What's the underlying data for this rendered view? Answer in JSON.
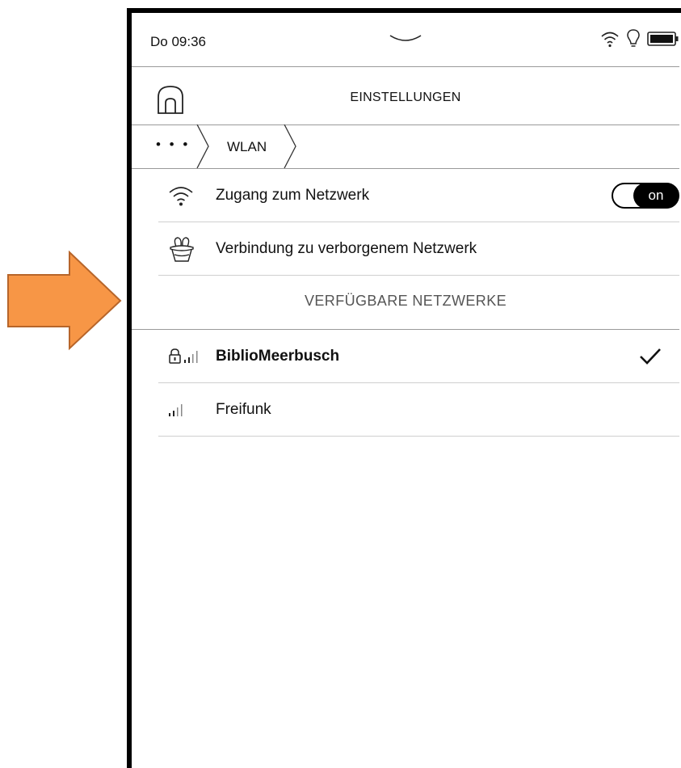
{
  "status_bar": {
    "time": "Do 09:36"
  },
  "header": {
    "title": "EINSTELLUNGEN"
  },
  "breadcrumb": {
    "more": "• • •",
    "current": "WLAN"
  },
  "settings": {
    "network_access": {
      "label": "Zugang zum Netzwerk",
      "toggle": "on"
    },
    "hidden_network": {
      "label": "Verbindung zu verborgenem Netzwerk"
    }
  },
  "available_networks": {
    "heading": "VERFÜGBARE NETZWERKE",
    "items": [
      {
        "name": "BiblioMeerbusch",
        "secured": true,
        "connected": true
      },
      {
        "name": "Freifunk",
        "secured": false,
        "connected": false
      }
    ]
  },
  "colors": {
    "arrow_fill": "#F79646",
    "arrow_stroke": "#B7652A",
    "frame": "#000000"
  },
  "icons": [
    "home-icon",
    "wifi-icon",
    "bulb-icon",
    "battery-icon",
    "hidden-network-icon",
    "lock-icon",
    "signal-icon",
    "checkmark-icon",
    "chevron-down-icon"
  ]
}
